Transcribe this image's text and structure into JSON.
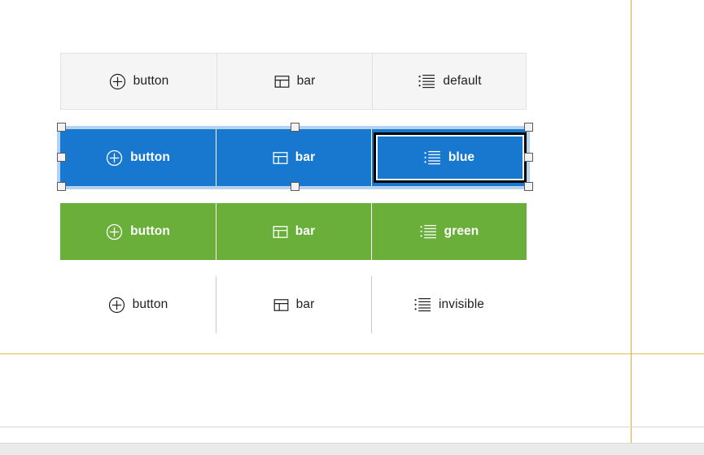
{
  "canvas": {
    "background": "#ffffff",
    "guide_color": "#f0a830",
    "guide_vertical_x": "775",
    "guide_horizontal_y": "435"
  },
  "colors": {
    "default_bg": "#f5f5f5",
    "default_border": "#e2e2e2",
    "default_text": "#1f1f1f",
    "blue": "#1878cf",
    "green": "#6aaf3a",
    "white": "#ffffff",
    "focus_outline": "#000000",
    "selection": "#78afe6",
    "handle_fill": "#f2f2f2",
    "handle_border": "#5a5a5a",
    "divider_invisible": "#c9c9c9"
  },
  "groups": [
    {
      "id": "default",
      "variant_label": "default",
      "segments": [
        {
          "icon": "plus-circle-icon",
          "label": "button"
        },
        {
          "icon": "layout-bar-icon",
          "label": "bar"
        },
        {
          "icon": "list-bullet-icon",
          "label": "default"
        }
      ]
    },
    {
      "id": "blue",
      "variant_label": "blue",
      "selected": "true",
      "focused_segment": "2",
      "segments": [
        {
          "icon": "plus-circle-icon",
          "label": "button"
        },
        {
          "icon": "layout-bar-icon",
          "label": "bar"
        },
        {
          "icon": "list-bullet-icon",
          "label": "blue"
        }
      ]
    },
    {
      "id": "green",
      "variant_label": "green",
      "segments": [
        {
          "icon": "plus-circle-icon",
          "label": "button"
        },
        {
          "icon": "layout-bar-icon",
          "label": "bar"
        },
        {
          "icon": "list-bullet-icon",
          "label": "green"
        }
      ]
    },
    {
      "id": "invisible",
      "variant_label": "invisible",
      "segments": [
        {
          "icon": "plus-circle-icon",
          "label": "button"
        },
        {
          "icon": "layout-bar-icon",
          "label": "bar"
        },
        {
          "icon": "list-bullet-icon",
          "label": "invisible"
        }
      ]
    }
  ],
  "selection_handles": [
    {
      "name": "handle-top-left",
      "x": "70",
      "y": "151"
    },
    {
      "name": "handle-top-center",
      "x": "357",
      "y": "151"
    },
    {
      "name": "handle-top-right",
      "x": "644",
      "y": "151"
    },
    {
      "name": "handle-middle-left",
      "x": "70",
      "y": "188"
    },
    {
      "name": "handle-middle-right",
      "x": "644",
      "y": "188"
    },
    {
      "name": "handle-bottom-left",
      "x": "70",
      "y": "224"
    },
    {
      "name": "handle-bottom-center",
      "x": "357",
      "y": "224"
    },
    {
      "name": "handle-bottom-right",
      "x": "644",
      "y": "224"
    }
  ]
}
